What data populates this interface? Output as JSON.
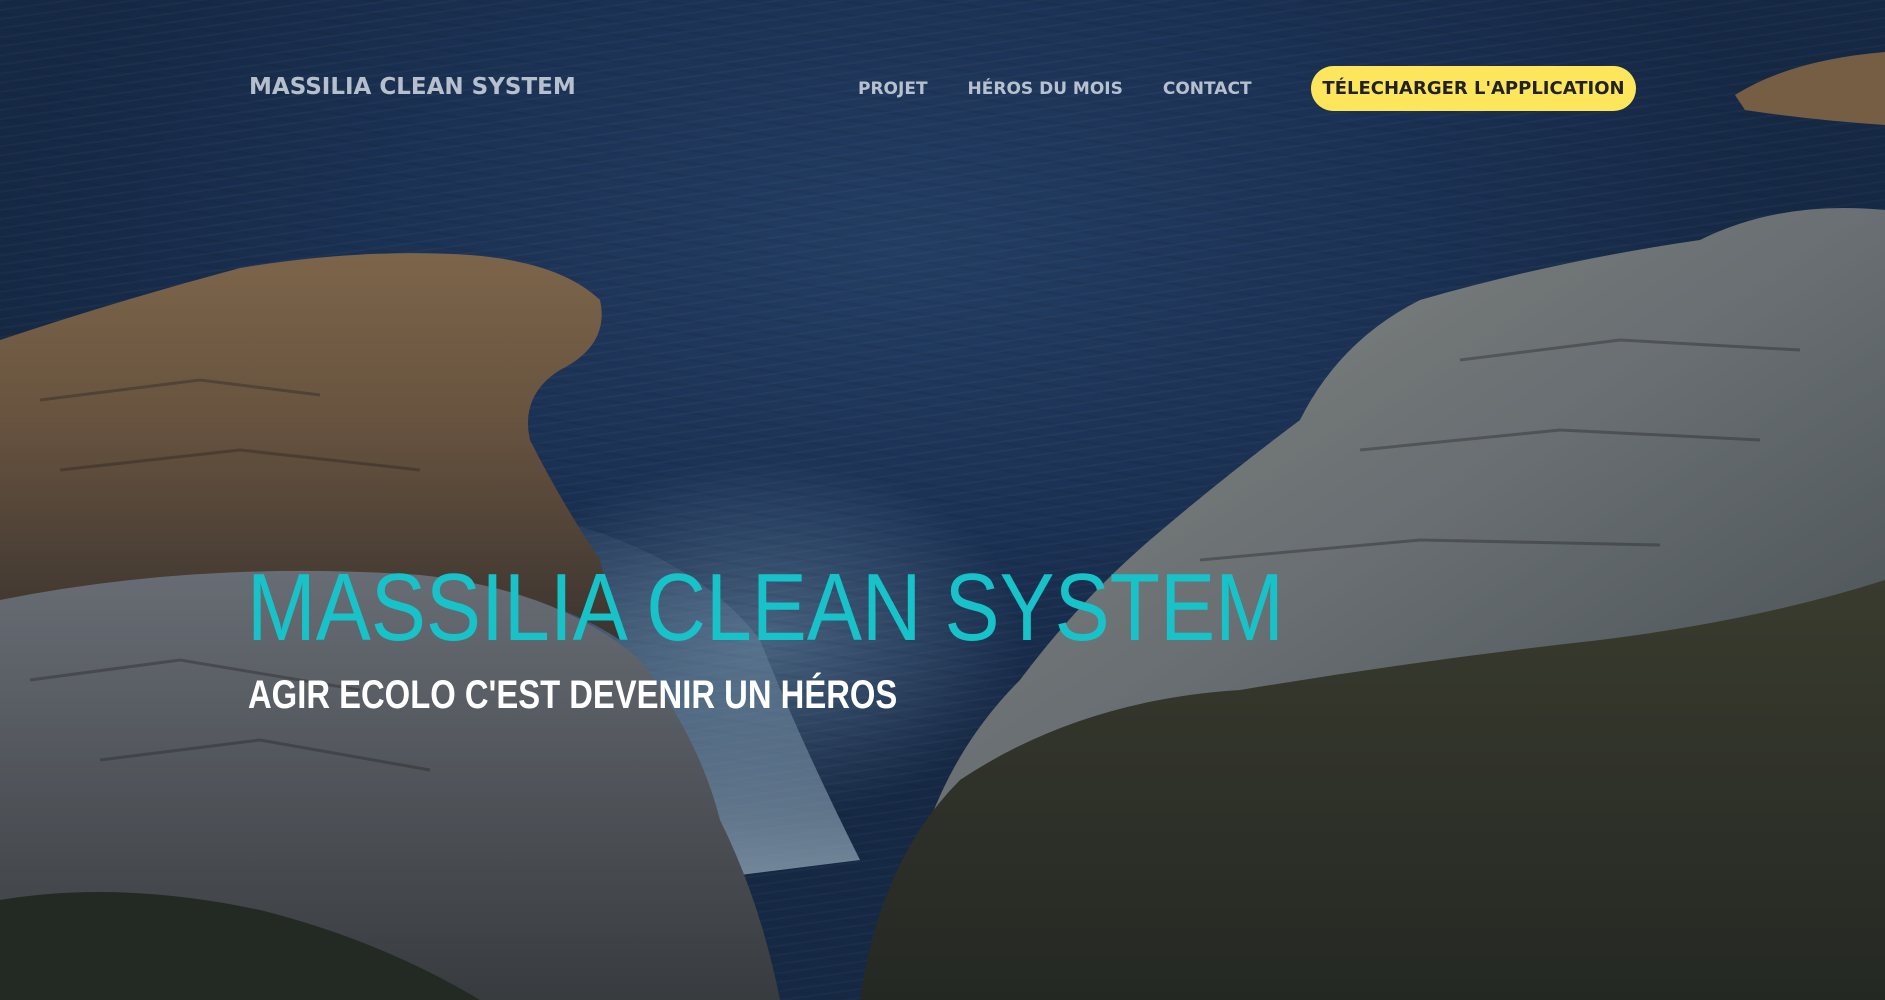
{
  "nav": {
    "brand": "MASSILIA CLEAN SYSTEM",
    "links": [
      {
        "label": "PROJET"
      },
      {
        "label": "HÉROS DU MOIS"
      },
      {
        "label": "CONTACT"
      }
    ],
    "cta_label": "TÉLECHARGER L'APPLICATION"
  },
  "hero": {
    "title": "MASSILIA CLEAN SYSTEM",
    "subtitle": "AGIR ECOLO C'EST DEVENIR UN HÉROS",
    "background": "coastal-rocks-sea-photo"
  },
  "colors": {
    "accent_title": "#17c3c8",
    "cta_background": "#fde65c",
    "nav_text": "#e1e8f0",
    "subtitle_text": "#ffffff"
  }
}
